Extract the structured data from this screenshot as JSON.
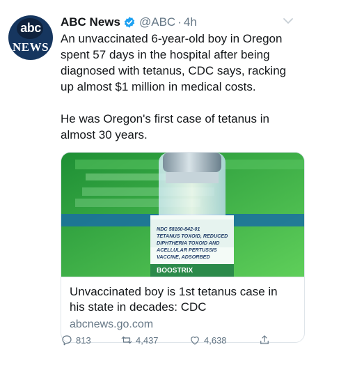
{
  "tweet": {
    "avatar_logo_text": "abc",
    "avatar_wordmark": "NEWS",
    "author_name": "ABC News",
    "handle": "@ABC",
    "separator": "·",
    "time": "4h",
    "text_paragraph_1": "An unvaccinated 6-year-old boy in Oregon spent 57 days in the hospital after being diagnosed with tetanus, CDC says, racking up almost $1 million in medical costs.",
    "text_paragraph_2": "He was Oregon's first case of tetanus in almost 30 years.",
    "card": {
      "image_subject": "Boostrix vaccine vial",
      "image_label_lines": [
        "NDC 58160-842-01",
        "TETANUS TOXOID, REDUCED",
        "DIPHTHERIA TOXOID AND",
        "ACELLULAR PERTUSSIS",
        "VACCINE, ADSORBED"
      ],
      "image_brand": "BOOSTRIX",
      "title": "Unvaccinated boy is 1st tetanus case in his state in decades: CDC",
      "domain": "abcnews.go.com"
    },
    "actions": {
      "reply_count": "813",
      "retweet_count": "4,437",
      "like_count": "4,638"
    }
  },
  "icons": {
    "verified": "verified-badge-icon",
    "caret": "chevron-down-icon",
    "reply": "reply-icon",
    "retweet": "retweet-icon",
    "like": "heart-icon",
    "share": "share-icon"
  },
  "colors": {
    "text": "#14171a",
    "secondary": "#657786",
    "verified": "#1da1f2",
    "border": "#dfe5ea",
    "avatar_bg": "#16365f",
    "image_green": "#39b24c"
  }
}
